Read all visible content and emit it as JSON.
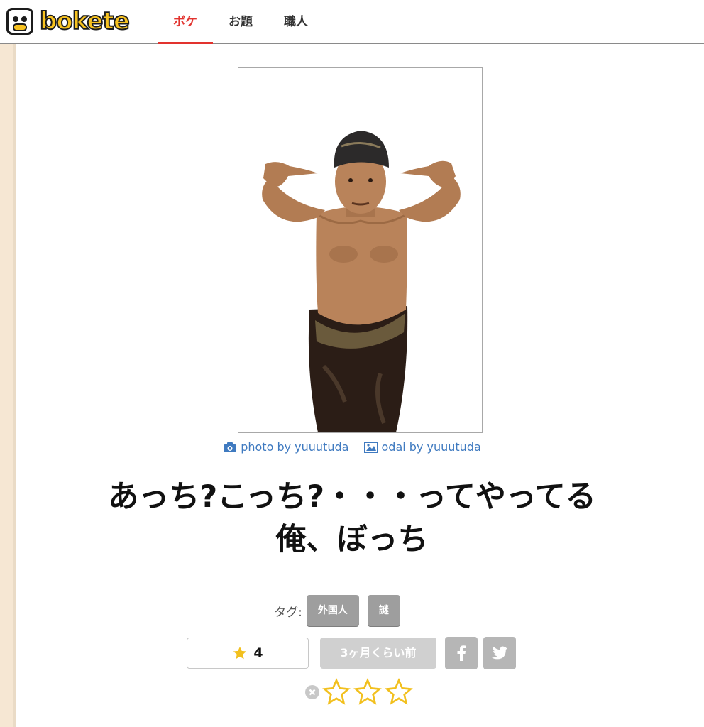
{
  "header": {
    "logo_text": "bokete",
    "nav": [
      "ボケ",
      "お題",
      "職人"
    ]
  },
  "credits": {
    "photo": "photo by yuuutuda",
    "odai": "odai by yuuutuda"
  },
  "boke": {
    "line1": "あっち?こっち?・・・ってやってる",
    "line2": "俺、ぼっち"
  },
  "tags": {
    "label": "タグ:",
    "items": [
      "外国人",
      "謎"
    ]
  },
  "rating": {
    "stars_count": "4",
    "time_ago": "3ヶ月くらい前",
    "rating_options": 3
  },
  "colors": {
    "accent": "#e2332e",
    "link": "#3f7ac0",
    "star": "#f2c01e",
    "tag_bg": "#9e9e9e"
  }
}
